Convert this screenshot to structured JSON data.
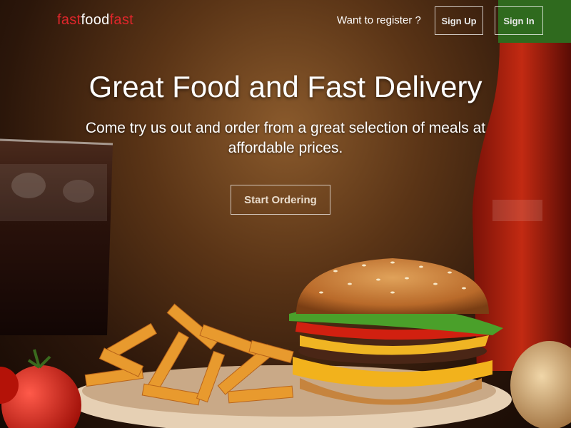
{
  "navbar": {
    "logo": {
      "part1": "fast",
      "part2": "food",
      "part3": "fast"
    },
    "register_prompt": "Want to register ?",
    "signup_label": "Sign Up",
    "signin_label": "Sign In"
  },
  "hero": {
    "title": "Great Food and Fast Delivery",
    "subtitle": "Come try us out and order from a great selection of meals at affordable prices.",
    "cta_label": "Start Ordering"
  },
  "colors": {
    "brand_red": "#e0262b",
    "text_white": "#ffffff"
  }
}
